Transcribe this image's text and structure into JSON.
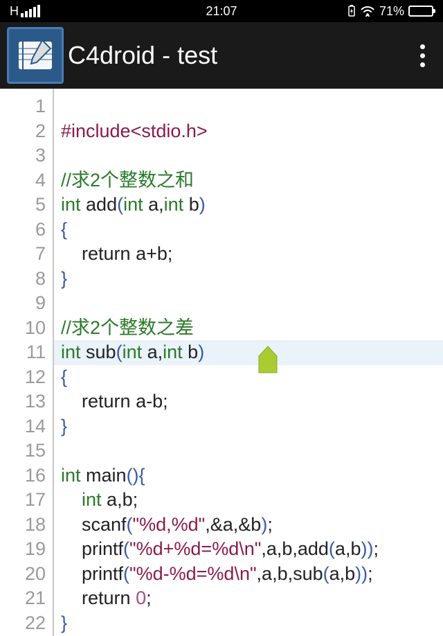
{
  "status": {
    "network": "H",
    "time": "21:07",
    "battery_pct": "71%"
  },
  "app": {
    "title": "C4droid - test"
  },
  "editor": {
    "current_line": 11,
    "gutter": [
      "1",
      "2",
      "3",
      "4",
      "5",
      "6",
      "7",
      "8",
      "9",
      "10",
      "11",
      "12",
      "13",
      "14",
      "15",
      "16",
      "17",
      "18",
      "19",
      "20",
      "21",
      "22"
    ],
    "lines": [
      [],
      [
        {
          "c": "c-include",
          "t": "#include<stdio.h>"
        }
      ],
      [],
      [
        {
          "c": "c-comment",
          "t": "//求2个整数之和"
        }
      ],
      [
        {
          "c": "c-type",
          "t": "int"
        },
        {
          "c": "c-op",
          "t": " add"
        },
        {
          "c": "c-paren",
          "t": "("
        },
        {
          "c": "c-type",
          "t": "int"
        },
        {
          "c": "c-op",
          "t": " a,"
        },
        {
          "c": "c-type",
          "t": "int"
        },
        {
          "c": "c-op",
          "t": " b"
        },
        {
          "c": "c-paren",
          "t": ")"
        }
      ],
      [
        {
          "c": "c-brace",
          "t": "{"
        }
      ],
      [
        {
          "c": "c-op",
          "t": "    "
        },
        {
          "c": "c-keyword",
          "t": "return"
        },
        {
          "c": "c-op",
          "t": " a+b;"
        }
      ],
      [
        {
          "c": "c-brace",
          "t": "}"
        }
      ],
      [],
      [
        {
          "c": "c-comment",
          "t": "//求2个整数之差"
        }
      ],
      [
        {
          "c": "c-type",
          "t": "int"
        },
        {
          "c": "c-op",
          "t": " sub"
        },
        {
          "c": "c-paren",
          "t": "("
        },
        {
          "c": "c-type",
          "t": "int"
        },
        {
          "c": "c-op",
          "t": " a,"
        },
        {
          "c": "c-type",
          "t": "int"
        },
        {
          "c": "c-op",
          "t": " b"
        },
        {
          "c": "c-paren",
          "t": ")"
        }
      ],
      [
        {
          "c": "c-brace",
          "t": "{"
        }
      ],
      [
        {
          "c": "c-op",
          "t": "    "
        },
        {
          "c": "c-keyword",
          "t": "return"
        },
        {
          "c": "c-op",
          "t": " a-b;"
        }
      ],
      [
        {
          "c": "c-brace",
          "t": "}"
        }
      ],
      [],
      [
        {
          "c": "c-type",
          "t": "int"
        },
        {
          "c": "c-op",
          "t": " main"
        },
        {
          "c": "c-paren",
          "t": "()"
        },
        {
          "c": "c-brace",
          "t": "{"
        }
      ],
      [
        {
          "c": "c-op",
          "t": "    "
        },
        {
          "c": "c-type",
          "t": "int"
        },
        {
          "c": "c-op",
          "t": " a,b;"
        }
      ],
      [
        {
          "c": "c-op",
          "t": "    scanf"
        },
        {
          "c": "c-paren",
          "t": "("
        },
        {
          "c": "c-str",
          "t": "\"%d,%d\""
        },
        {
          "c": "c-op",
          "t": ",&a,&b"
        },
        {
          "c": "c-paren",
          "t": ")"
        },
        {
          "c": "c-op",
          "t": ";"
        }
      ],
      [
        {
          "c": "c-op",
          "t": "    printf"
        },
        {
          "c": "c-paren",
          "t": "("
        },
        {
          "c": "c-str",
          "t": "\"%d+%d=%d\\n\""
        },
        {
          "c": "c-op",
          "t": ",a,b,add"
        },
        {
          "c": "c-paren",
          "t": "("
        },
        {
          "c": "c-op",
          "t": "a,b"
        },
        {
          "c": "c-paren",
          "t": "))"
        },
        {
          "c": "c-op",
          "t": ";"
        }
      ],
      [
        {
          "c": "c-op",
          "t": "    printf"
        },
        {
          "c": "c-paren",
          "t": "("
        },
        {
          "c": "c-str",
          "t": "\"%d-%d=%d\\n\""
        },
        {
          "c": "c-op",
          "t": ",a,b,sub"
        },
        {
          "c": "c-paren",
          "t": "("
        },
        {
          "c": "c-op",
          "t": "a,b"
        },
        {
          "c": "c-paren",
          "t": "))"
        },
        {
          "c": "c-op",
          "t": ";"
        }
      ],
      [
        {
          "c": "c-op",
          "t": "    "
        },
        {
          "c": "c-keyword",
          "t": "return"
        },
        {
          "c": "c-op",
          "t": " "
        },
        {
          "c": "c-num",
          "t": "0"
        },
        {
          "c": "c-op",
          "t": ";"
        }
      ],
      [
        {
          "c": "c-brace",
          "t": "}"
        }
      ]
    ]
  }
}
